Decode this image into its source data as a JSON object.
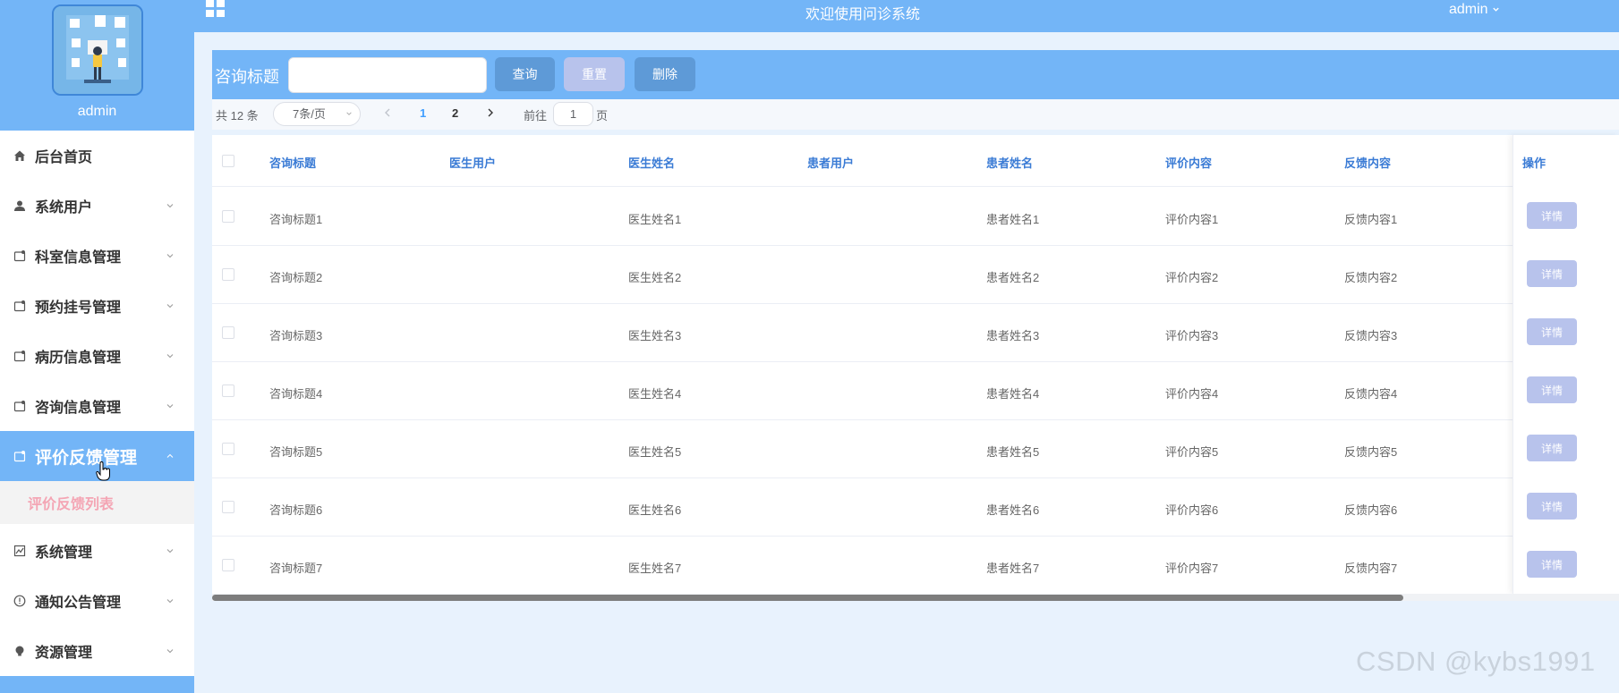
{
  "sidebar": {
    "username": "admin",
    "items": [
      {
        "label": "后台首页"
      },
      {
        "label": "系统用户"
      },
      {
        "label": "科室信息管理"
      },
      {
        "label": "预约挂号管理"
      },
      {
        "label": "病历信息管理"
      },
      {
        "label": "咨询信息管理"
      },
      {
        "label": "评价反馈管理"
      },
      {
        "label": "系统管理"
      },
      {
        "label": "通知公告管理"
      },
      {
        "label": "资源管理"
      }
    ],
    "active_sub": "评价反馈列表"
  },
  "header": {
    "title": "欢迎使用问诊系统",
    "user": "admin"
  },
  "search": {
    "label": "咨询标题",
    "value": "",
    "query_label": "查询",
    "reset_label": "重置",
    "delete_label": "删除"
  },
  "pagination": {
    "total": "共 12 条",
    "page_size": "7条/页",
    "pages": [
      "1",
      "2"
    ],
    "current": "1",
    "goto_label": "前往",
    "goto_value": "1",
    "page_label": "页"
  },
  "table": {
    "columns": [
      "咨询标题",
      "医生用户",
      "医生姓名",
      "患者用户",
      "患者姓名",
      "评价内容",
      "反馈内容",
      "操作"
    ],
    "rows": [
      [
        "咨询标题1",
        "",
        "医生姓名1",
        "",
        "患者姓名1",
        "评价内容1",
        "反馈内容1"
      ],
      [
        "咨询标题2",
        "",
        "医生姓名2",
        "",
        "患者姓名2",
        "评价内容2",
        "反馈内容2"
      ],
      [
        "咨询标题3",
        "",
        "医生姓名3",
        "",
        "患者姓名3",
        "评价内容3",
        "反馈内容3"
      ],
      [
        "咨询标题4",
        "",
        "医生姓名4",
        "",
        "患者姓名4",
        "评价内容4",
        "反馈内容4"
      ],
      [
        "咨询标题5",
        "",
        "医生姓名5",
        "",
        "患者姓名5",
        "评价内容5",
        "反馈内容5"
      ],
      [
        "咨询标题6",
        "",
        "医生姓名6",
        "",
        "患者姓名6",
        "评价内容6",
        "反馈内容6"
      ],
      [
        "咨询标题7",
        "",
        "医生姓名7",
        "",
        "患者姓名7",
        "评价内容7",
        "反馈内容7"
      ]
    ],
    "detail_label": "详情"
  },
  "watermark": "CSDN @kybs1991",
  "colors": {
    "primary": "#73b5f7",
    "button": "#5e9ad7",
    "button_light": "#b8c3ec",
    "active_sub_text": "#f4a5b4",
    "header_text": "#3a7bd5"
  },
  "icons": {
    "menu_toggle": "grid-icon",
    "home": "home-icon",
    "user": "user-icon",
    "folder": "folder-icon",
    "chart": "chart-icon",
    "info": "info-icon",
    "bulb": "bulb-icon"
  }
}
